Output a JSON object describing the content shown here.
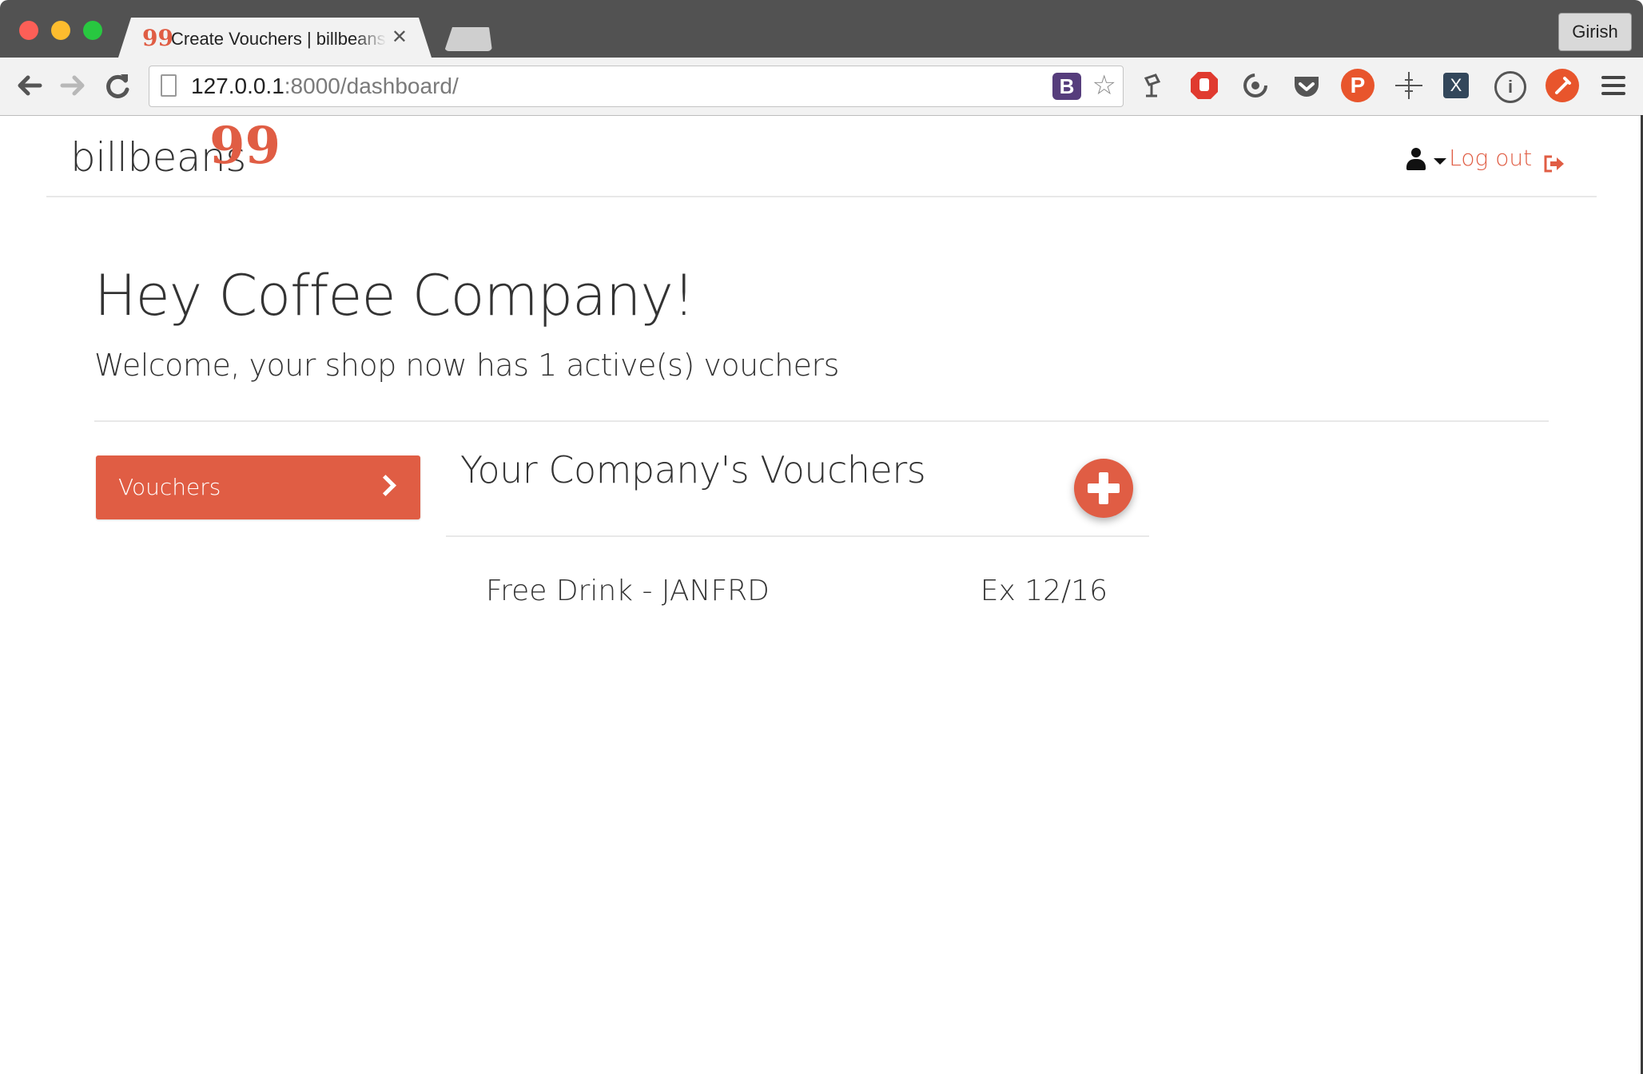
{
  "browser": {
    "tab_title": "Create Vouchers | billbeans",
    "tab_close": "✕",
    "profile_name": "Girish",
    "url_host": "127.0.0.1",
    "url_path": ":8000/dashboard/",
    "omnibox_extension": "B",
    "extensions": [
      "lamp-icon",
      "stop-hand-icon",
      "sync-icon",
      "pocket-icon",
      "p-badge-icon",
      "crosshair-icon",
      "x-box-icon",
      "info-icon",
      "eyedropper-icon",
      "menu-icon"
    ],
    "extension_letters": {
      "p": "P",
      "x": "X",
      "info": "i"
    }
  },
  "navbar": {
    "brand": "billbeans",
    "brand_mark": "99",
    "logout_label": "Log out"
  },
  "hero": {
    "title": "Hey Coffee Company!",
    "subtitle": "Welcome, your shop now has 1 active(s) vouchers"
  },
  "sidebar": {
    "vouchers_label": "Vouchers"
  },
  "vouchers_panel": {
    "title": "Your Company's Vouchers",
    "items": [
      {
        "name": "Free Drink - JANFRD",
        "expiry": "Ex 12/16"
      }
    ]
  },
  "colors": {
    "accent": "#e05d44",
    "titlebar": "#525252",
    "toolbar": "#f2f2f2"
  }
}
